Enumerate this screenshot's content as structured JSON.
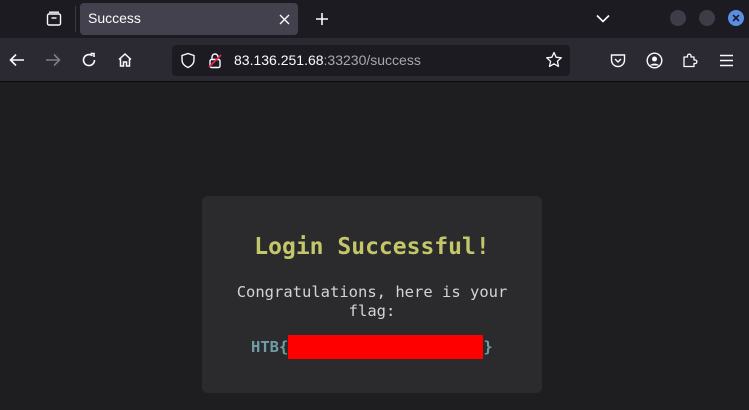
{
  "browser": {
    "tab_title": "Success",
    "url_host": "83.136.251.68",
    "url_rest": ":33230/success"
  },
  "page": {
    "title": "Login Successful!",
    "message": "Congratulations, here is your flag:",
    "flag_prefix": "HTB{",
    "flag_suffix": "}"
  },
  "colors": {
    "title": "#c3c768",
    "flag": "#6f9da6",
    "redaction": "#ff0000",
    "card": "#2b2b2e",
    "page_bg": "#1e1e20"
  },
  "icons": [
    "tab-manager-icon",
    "close-icon",
    "plus-icon",
    "chevron-down-icon",
    "back-arrow-icon",
    "forward-arrow-icon",
    "reload-icon",
    "home-icon",
    "shield-icon",
    "lock-icon",
    "star-icon",
    "pocket-icon",
    "account-icon",
    "extensions-icon",
    "menu-icon"
  ]
}
